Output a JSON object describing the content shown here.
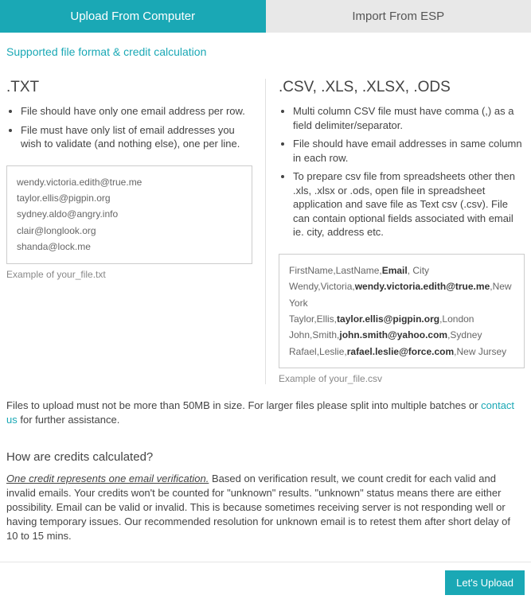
{
  "tabs": {
    "upload": "Upload From Computer",
    "import": "Import From ESP"
  },
  "section_title": "Supported file format & credit calculation",
  "txt": {
    "header": ".TXT",
    "bullets": [
      "File should have only one email address per row.",
      "File must have only list of email addresses you wish to validate (and nothing else), one per line."
    ],
    "example_lines": [
      "wendy.victoria.edith@true.me",
      "taylor.ellis@pigpin.org",
      "sydney.aldo@angry.info",
      "clair@longlook.org",
      "shanda@lock.me"
    ],
    "example_caption": "Example of your_file.txt"
  },
  "csv": {
    "header": ".CSV, .XLS, .XLSX, .ODS",
    "bullets": [
      "Multi column CSV file must have comma (,) as a field delimiter/separator.",
      "File should have email addresses in same column in each row.",
      "To prepare csv file from spreadsheets other then .xls, .xlsx or .ods, open file in spreadsheet application and save file as Text csv (.csv). File can contain optional fields associated with email ie. city, address etc."
    ],
    "example_rows": [
      {
        "pre": "FirstName,LastName,",
        "bold": "Email",
        "post": ", City"
      },
      {
        "pre": "Wendy,Victoria,",
        "bold": "wendy.victoria.edith@true.me",
        "post": ",New York"
      },
      {
        "pre": "Taylor,Ellis,",
        "bold": "taylor.ellis@pigpin.org",
        "post": ",London"
      },
      {
        "pre": "John,Smith,",
        "bold": "john.smith@yahoo.com",
        "post": ",Sydney"
      },
      {
        "pre": "Rafael,Leslie,",
        "bold": "rafael.leslie@force.com",
        "post": ",New Jursey"
      }
    ],
    "example_caption": "Example of your_file.csv"
  },
  "note": {
    "before": "Files to upload must not be more than 50MB in size. For larger files please split into multiple batches or ",
    "link": "contact us",
    "after": " for further assistance."
  },
  "credits": {
    "header": "How are credits calculated?",
    "lead": "One credit represents one email verification.",
    "body": " Based on verification result, we count credit for each valid and invalid emails. Your credits won't be counted for \"unknown\" results. \"unknown\" status means there are either possibility. Email can be valid or invalid. This is because sometimes receiving server is not responding well or having temporary issues. Our recommended resolution for unknown email is to retest them after short delay of 10 to 15 mins."
  },
  "buttons": {
    "upload": "Let's Upload"
  }
}
